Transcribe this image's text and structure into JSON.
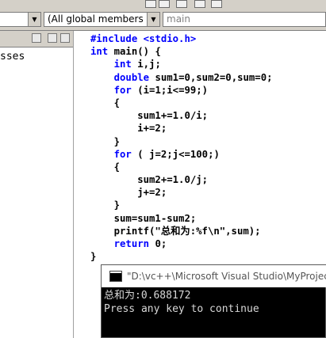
{
  "toolbar": {
    "members_value": "(All global members",
    "function_value": "main"
  },
  "left_pane": {
    "item_label": "sses"
  },
  "code_lines": [
    [
      {
        "t": "#include <stdio.h>",
        "c": "kw"
      }
    ],
    [
      {
        "t": "int",
        "c": "kw"
      },
      {
        "t": " main() {",
        "c": "tx"
      }
    ],
    [
      {
        "t": "    ",
        "c": "tx"
      },
      {
        "t": "int",
        "c": "kw"
      },
      {
        "t": " i,j;",
        "c": "tx"
      }
    ],
    [
      {
        "t": "    ",
        "c": "tx"
      },
      {
        "t": "double",
        "c": "kw"
      },
      {
        "t": " sum1=0,sum2=0,sum=0;",
        "c": "tx"
      }
    ],
    [
      {
        "t": "    ",
        "c": "tx"
      },
      {
        "t": "for",
        "c": "kw"
      },
      {
        "t": " (i=1;i<=99;)",
        "c": "tx"
      }
    ],
    [
      {
        "t": "    {",
        "c": "tx"
      }
    ],
    [
      {
        "t": "        sum1+=1.0/i;",
        "c": "tx"
      }
    ],
    [
      {
        "t": "        i+=2;",
        "c": "tx"
      }
    ],
    [
      {
        "t": "    }",
        "c": "tx"
      }
    ],
    [
      {
        "t": "    ",
        "c": "tx"
      },
      {
        "t": "for",
        "c": "kw"
      },
      {
        "t": " ( j=2;j<=100;)",
        "c": "tx"
      }
    ],
    [
      {
        "t": "    {",
        "c": "tx"
      }
    ],
    [
      {
        "t": "        sum2+=1.0/j;",
        "c": "tx"
      }
    ],
    [
      {
        "t": "        j+=2;",
        "c": "tx"
      }
    ],
    [
      {
        "t": "    }",
        "c": "tx"
      }
    ],
    [
      {
        "t": "    sum=sum1-sum2;",
        "c": "tx"
      }
    ],
    [
      {
        "t": "    printf(\"总和为:%f\\n\",sum);",
        "c": "tx"
      }
    ],
    [
      {
        "t": "    ",
        "c": "tx"
      },
      {
        "t": "return",
        "c": "kw"
      },
      {
        "t": " 0;",
        "c": "tx"
      }
    ],
    [
      {
        "t": "}",
        "c": "tx"
      }
    ]
  ],
  "console": {
    "title": "\"D:\\vc++\\Microsoft Visual Studio\\MyProjec",
    "output_line1": "总和为:0.688172",
    "output_line2": "Press any key to continue"
  },
  "colors": {
    "keyword": "#0000ff",
    "text": "#000000",
    "chrome": "#d4d0c8",
    "console_bg": "#000000"
  }
}
